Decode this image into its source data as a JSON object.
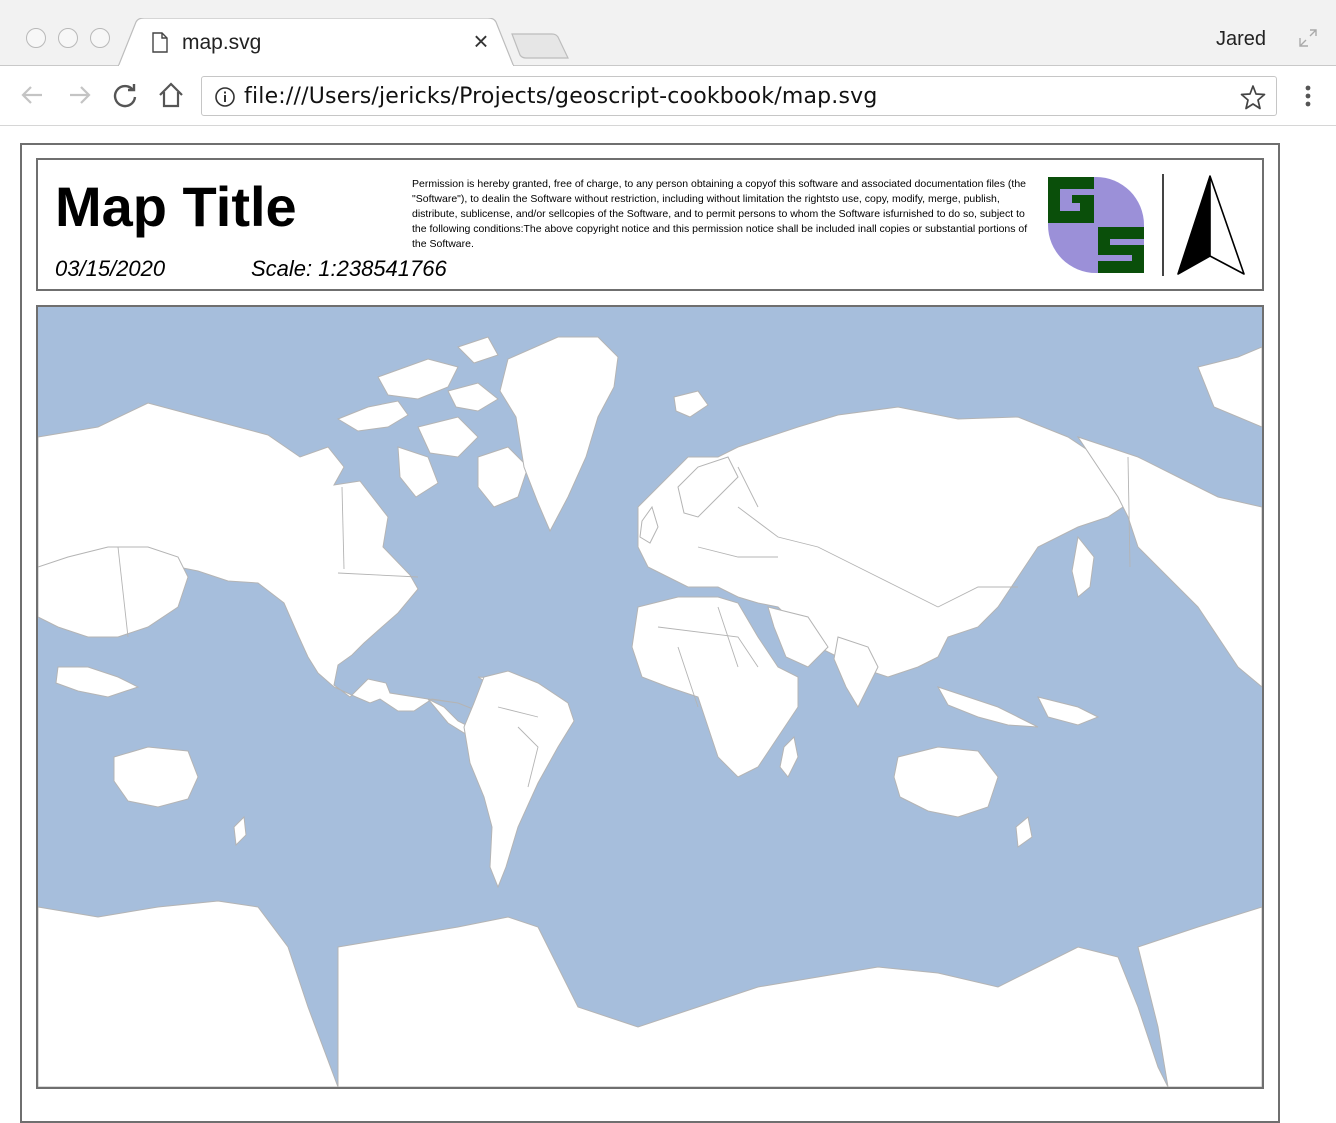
{
  "browser": {
    "tab": {
      "title": "map.svg",
      "close_glyph": "×"
    },
    "profile_name": "Jared",
    "address_bar": {
      "url": "file:///Users/jericks/Projects/geoscript-cookbook/map.svg"
    },
    "icons": {
      "back": "back-arrow-icon",
      "forward": "forward-arrow-icon",
      "reload": "reload-icon",
      "home": "home-icon",
      "info": "info-icon",
      "bookmark": "star-icon",
      "menu": "kebab-menu-icon",
      "fullscreen": "fullscreen-icon",
      "favicon": "document-icon"
    }
  },
  "map": {
    "title": "Map Title",
    "date": "03/15/2020",
    "scale": "Scale: 1:238541766",
    "license": "Permission is hereby granted, free of charge, to any person obtaining a copyof this software and associated documentation files (the \"Software\"), to dealin the Software without restriction, including without limitation the rightsto use, copy, modify, merge, publish, distribute, sublicense, and/or sellcopies of the Software, and to permit persons to whom the Software isfurnished to do so, subject to the following conditions:The above copyright notice and this permission notice shall be included inall copies or substantial portions of the Software.",
    "logo": "GS",
    "colors": {
      "ocean": "#a6bedc",
      "land": "#ffffff",
      "borders": "#b4b4b4",
      "frame": "#6f6f6f",
      "logo_green": "#0a4f0a",
      "logo_purple": "#9b90d8"
    }
  }
}
